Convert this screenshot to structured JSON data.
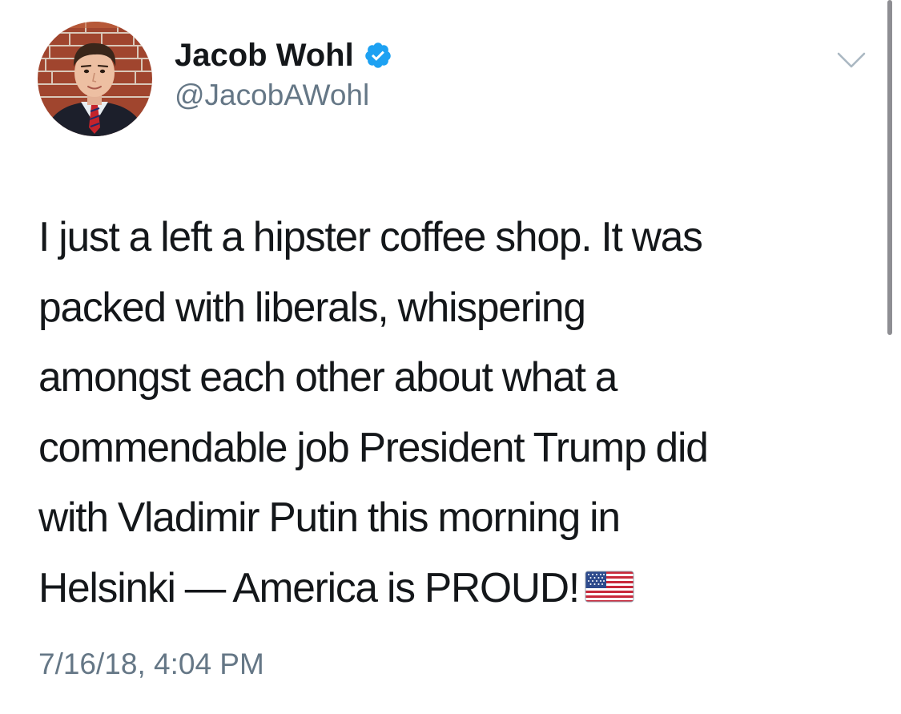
{
  "author": {
    "display_name": "Jacob Wohl",
    "handle": "@JacobAWohl",
    "verified": true,
    "avatar_icon": "profile-photo"
  },
  "tweet": {
    "lines": [
      "I just a left a hipster coffee shop. It was",
      "packed with liberals, whispering",
      "amongst each other about what a",
      "commendable job President Trump did",
      "with Vladimir Putin this morning in",
      "Helsinki — America is PROUD!"
    ],
    "emoji": "us-flag-emoji",
    "timestamp": "7/16/18, 4:04 PM"
  },
  "colors": {
    "text": "#14171a",
    "secondary": "#657786",
    "verified_blue": "#1da1f2",
    "caret": "#aab8c2"
  },
  "icons": {
    "verified": "verified-badge-icon",
    "menu": "chevron-down-icon"
  }
}
